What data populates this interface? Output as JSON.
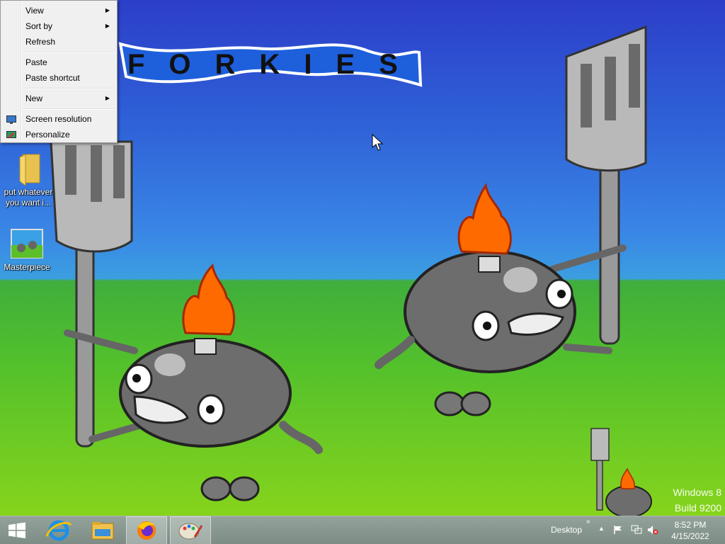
{
  "context_menu": {
    "items": [
      {
        "label": "View",
        "has_submenu": true
      },
      {
        "label": "Sort by",
        "has_submenu": true
      },
      {
        "label": "Refresh",
        "has_submenu": false
      },
      {
        "label": "Paste",
        "has_submenu": false
      },
      {
        "label": "Paste shortcut",
        "has_submenu": false
      },
      {
        "label": "New",
        "has_submenu": true
      },
      {
        "label": "Screen resolution",
        "has_submenu": false,
        "icon": "monitor-icon"
      },
      {
        "label": "Personalize",
        "has_submenu": false,
        "icon": "personalize-icon"
      }
    ]
  },
  "desktop": {
    "icons": [
      {
        "label": "put whatever you want i...",
        "icon": "folder-icon"
      },
      {
        "label": "Masterpiece",
        "icon": "image-file-icon"
      }
    ],
    "wallpaper_banner": "FORKIES",
    "watermark": {
      "line1": "Windows 8",
      "line2": "Build 9200"
    }
  },
  "taskbar": {
    "start_icon": "windows-logo-icon",
    "pinned": [
      {
        "name": "internet-explorer-icon",
        "active": false
      },
      {
        "name": "file-explorer-icon",
        "active": false
      },
      {
        "name": "firefox-icon",
        "active": true
      },
      {
        "name": "paint-icon",
        "active": true
      }
    ],
    "desktop_toolbar_label": "Desktop",
    "clock": {
      "time": "8:52 PM",
      "date": "4/15/2022"
    }
  },
  "colors": {
    "sky_top": "#2c3ec9",
    "grass": "#52c02c",
    "taskbar": "#8a9a93"
  }
}
